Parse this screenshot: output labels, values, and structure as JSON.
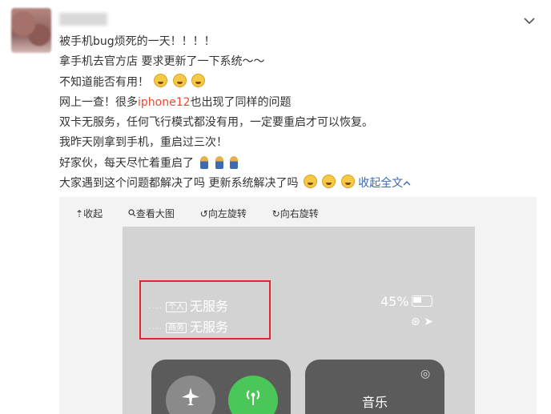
{
  "post": {
    "lines": [
      "被手机bug烦死的一天！！！！",
      "拿手机去官方店 要求更新了一下系统～～",
      "不知道能否有用！",
      "网上一查！很多",
      "双卡无服务，任何飞行模式都没有用，一定要重启才可以恢复。",
      "我昨天刚拿到手机，重启过三次！",
      "好家伙，每天尽忙着重启了",
      "大家遇到这个问题都解决了吗 更新系统解决了吗"
    ],
    "highlight": "iphone12",
    "line4_tail": "也出现了同样的问题",
    "collapse_link": "收起全文"
  },
  "toolbar": {
    "collapse": "收起",
    "view_large": "查看大图",
    "rotate_left": "向左旋转",
    "rotate_right": "向右旋转"
  },
  "screenshot": {
    "sim1_tag": "个人",
    "sim1_status": "无服务",
    "sim2_tag": "商务",
    "sim2_status": "无服务",
    "battery": "45%",
    "music_label": "音乐"
  }
}
